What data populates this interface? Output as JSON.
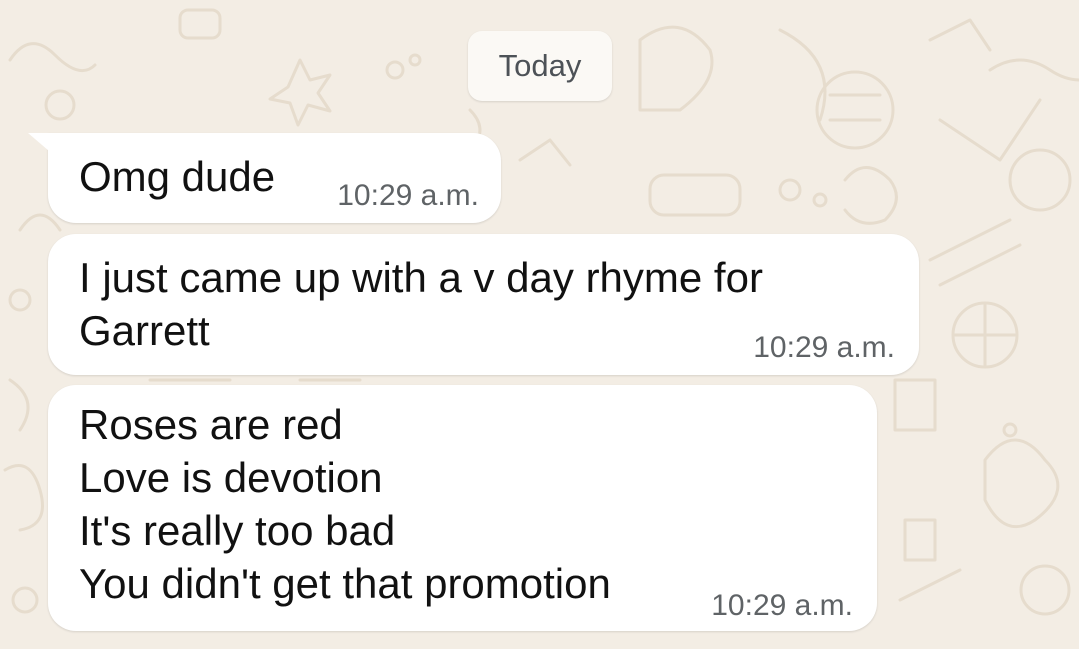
{
  "chat": {
    "date_label": "Today",
    "messages": [
      {
        "text": "Omg dude",
        "time": "10:29 a.m."
      },
      {
        "text": "I just came up with a v day rhyme for\nGarrett",
        "time": "10:29 a.m."
      },
      {
        "text": "Roses are red\nLove is devotion\nIt's really too bad\nYou didn't get that promotion",
        "time": "10:29 a.m."
      }
    ]
  },
  "colors": {
    "wallpaper": "#f3ede4",
    "bubble": "#ffffff",
    "timestamp": "#5f6366"
  }
}
